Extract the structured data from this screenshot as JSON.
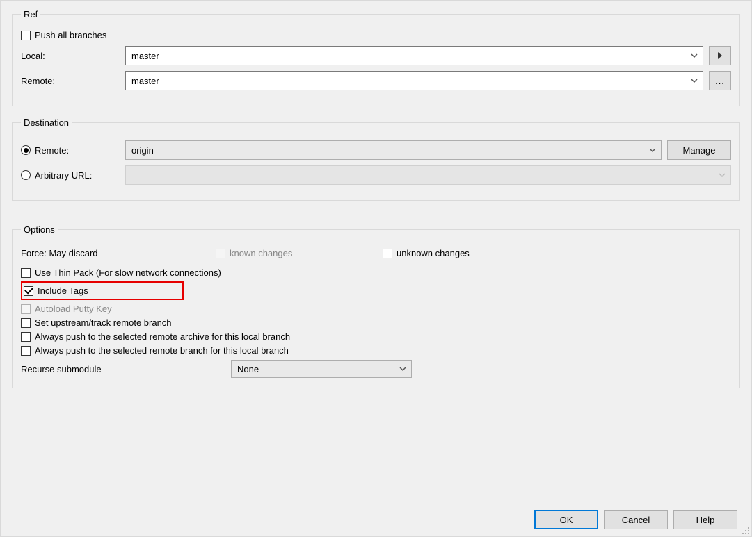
{
  "ref": {
    "legend": "Ref",
    "push_all_label": "Push all branches",
    "push_all_checked": false,
    "local_label": "Local:",
    "local_value": "master",
    "remote_label": "Remote:",
    "remote_value": "master"
  },
  "destination": {
    "legend": "Destination",
    "remote_label": "Remote:",
    "remote_selected": true,
    "remote_value": "origin",
    "manage_label": "Manage",
    "arbitrary_label": "Arbitrary URL:",
    "arbitrary_selected": false,
    "arbitrary_value": ""
  },
  "options": {
    "legend": "Options",
    "force_label": "Force: May discard",
    "known_changes_label": "known changes",
    "known_changes_checked": false,
    "unknown_changes_label": "unknown changes",
    "unknown_changes_checked": false,
    "thin_pack_label": "Use Thin Pack (For slow network connections)",
    "thin_pack_checked": false,
    "include_tags_label": "Include Tags",
    "include_tags_checked": true,
    "autoload_putty_label": "Autoload Putty Key",
    "autoload_putty_checked": false,
    "set_upstream_label": "Set upstream/track remote branch",
    "set_upstream_checked": false,
    "always_archive_label": "Always push to the selected remote archive for this local branch",
    "always_archive_checked": false,
    "always_branch_label": "Always push to the selected remote branch for this local branch",
    "always_branch_checked": false,
    "recurse_label": "Recurse submodule",
    "recurse_value": "None"
  },
  "buttons": {
    "ok": "OK",
    "cancel": "Cancel",
    "help": "Help"
  }
}
